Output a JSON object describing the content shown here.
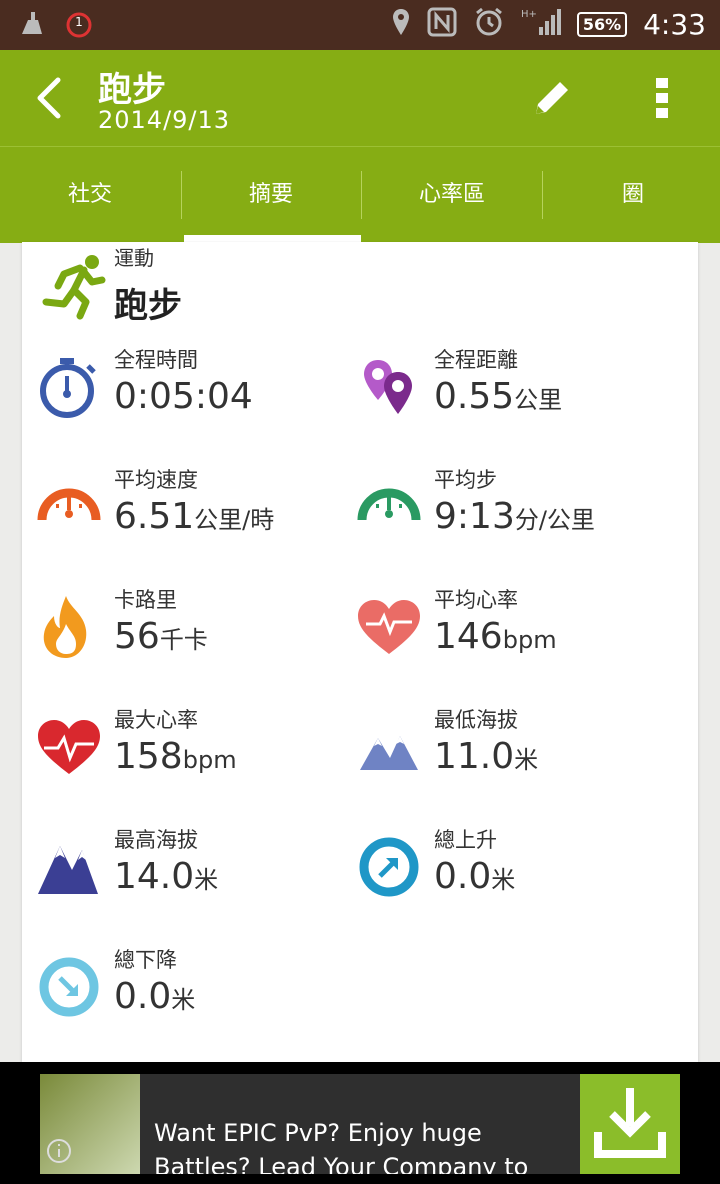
{
  "status_bar": {
    "notification_count": "1",
    "battery": "56%",
    "time": "4:33"
  },
  "header": {
    "title": "跑步",
    "date": "2014/9/13"
  },
  "tabs": [
    {
      "label": "社交",
      "active": false
    },
    {
      "label": "摘要",
      "active": true
    },
    {
      "label": "心率區",
      "active": false
    },
    {
      "label": "圈",
      "active": false
    }
  ],
  "sport": {
    "label": "運動",
    "value": "跑步"
  },
  "stats": [
    {
      "label": "全程時間",
      "value": "0:05:04",
      "unit": "",
      "icon": "stopwatch-icon",
      "color": "#3b5bab"
    },
    {
      "label": "全程距離",
      "value": "0.55",
      "unit": "公里",
      "icon": "map-pin-icon",
      "color": "#7b3a9c"
    },
    {
      "label": "平均速度",
      "value": "6.51",
      "unit": "公里/時",
      "icon": "speedometer-icon",
      "color": "#e85d22"
    },
    {
      "label": "平均步",
      "value": "9:13",
      "unit": "分/公里",
      "icon": "pace-gauge-icon",
      "color": "#2a9a62"
    },
    {
      "label": "卡路里",
      "value": "56",
      "unit": "千卡",
      "icon": "flame-icon",
      "color": "#f29a1e"
    },
    {
      "label": "平均心率",
      "value": "146",
      "unit": "bpm",
      "icon": "heart-pulse-icon",
      "color": "#ea6c66"
    },
    {
      "label": "最大心率",
      "value": "158",
      "unit": "bpm",
      "icon": "heart-max-icon",
      "color": "#d9282e"
    },
    {
      "label": "最低海拔",
      "value": "11.0",
      "unit": "米",
      "icon": "mountain-low-icon",
      "color": "#6f83c4"
    },
    {
      "label": "最高海拔",
      "value": "14.0",
      "unit": "米",
      "icon": "mountain-high-icon",
      "color": "#3b3f94"
    },
    {
      "label": "總上升",
      "value": "0.0",
      "unit": "米",
      "icon": "ascent-icon",
      "color": "#1f97c7"
    },
    {
      "label": "總下降",
      "value": "0.0",
      "unit": "米",
      "icon": "descent-icon",
      "color": "#6ec6e2"
    }
  ],
  "ad": {
    "text": "Want EPIC PvP? Enjoy huge Battles? Lead Your Company to"
  },
  "colors": {
    "accent": "#86ad14",
    "status_bar": "#4a2c20"
  }
}
